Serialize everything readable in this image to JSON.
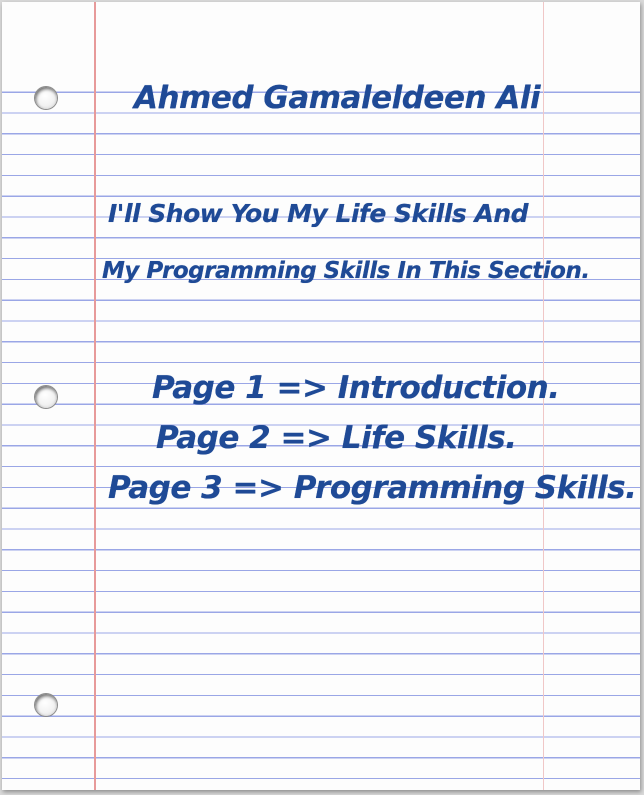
{
  "heading": {
    "author": "Ahmed Gamaleldeen Ali"
  },
  "intro": {
    "line1": "I'll Show You My Life Skills And",
    "line2": "My Programming Skills In This Section."
  },
  "pages": [
    "Page 1 => Introduction.",
    "Page 2 => Life Skills.",
    "Page 3 => Programming Skills."
  ],
  "colors": {
    "ink": "#1f4a96",
    "rule_lines": "#9aa6e6",
    "margin_line": "#e79a9a",
    "paper": "#fdfdfd"
  },
  "icons": [
    "binder-hole"
  ]
}
